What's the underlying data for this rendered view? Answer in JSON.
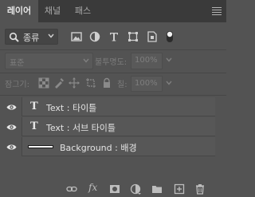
{
  "tabs": [
    {
      "label": "레이어"
    },
    {
      "label": "채널"
    },
    {
      "label": "패스"
    }
  ],
  "filter": {
    "kind_label": "종류",
    "icons": [
      "image-filter-icon",
      "adjustment-filter-icon",
      "type-filter-icon",
      "shape-filter-icon",
      "smart-object-filter-icon",
      "filter-toggle-icon"
    ]
  },
  "blend": {
    "mode": "표준",
    "opacity_label": "불투명도:",
    "opacity_value": "100%"
  },
  "lock": {
    "label": "잠그기:",
    "fill_label": "칠:",
    "fill_value": "100%",
    "icons": [
      "lock-transparent-pixels-icon",
      "lock-image-pixels-icon",
      "lock-position-icon",
      "lock-artboard-icon",
      "lock-all-icon"
    ]
  },
  "layers": [
    {
      "name": "Text : 타이틀",
      "kind": "type",
      "visible": true
    },
    {
      "name": "Text : 서브 타이틀",
      "kind": "type",
      "visible": true
    },
    {
      "name": "Background : 배경",
      "kind": "shape",
      "visible": true
    }
  ],
  "layer_type_glyph": "T",
  "footer": {
    "fx_label": "fx",
    "icons": [
      "link-layers-icon",
      "add-layer-style-icon",
      "add-mask-icon",
      "new-adjustment-layer-icon",
      "new-group-icon",
      "new-layer-icon",
      "delete-layer-icon"
    ]
  },
  "colors": {
    "panel_bg": "#535353",
    "tabbar_bg": "#3a3a3a",
    "row_bg": "#575757",
    "text": "#e4e4e4",
    "disabled_text": "#7c7c7c"
  }
}
